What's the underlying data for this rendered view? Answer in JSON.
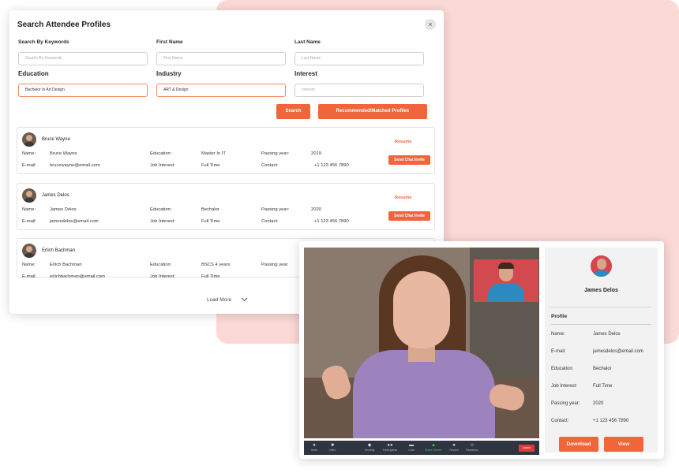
{
  "search": {
    "title": "Search Attendee Profiles",
    "close_icon": "×",
    "fields": {
      "keywords": {
        "label": "Search By Keywords",
        "placeholder": "Search By Keywords"
      },
      "first_name": {
        "label": "First Name",
        "placeholder": "First Name"
      },
      "last_name": {
        "label": "Last Name",
        "placeholder": "Last Name"
      },
      "education": {
        "label": "Education",
        "value": "Bachelor In Art Design"
      },
      "industry": {
        "label": "Industry",
        "value": "ART & Design"
      },
      "interest": {
        "label": "Interest",
        "placeholder": "Interest"
      }
    },
    "search_button": "Search",
    "matched_button": "Recommended/Matched Profiles",
    "load_more": "Load More"
  },
  "labels": {
    "name": "Name:",
    "email": "E-mail:",
    "education": "Education:",
    "job_interest": "Job Interest:",
    "passing_year": "Passing year:",
    "contact": "Contact:",
    "resume": "Resume",
    "send_invite": "Send Chat Invite"
  },
  "attendees": [
    {
      "name": "Bruce Wayne",
      "email": "brucewayne@email.com",
      "education": "Master In IT",
      "job_interest": "Full Time",
      "passing_year": "2019",
      "contact": "+1 123 456 7890"
    },
    {
      "name": "James Delos",
      "email": "jamesdelos@email.com",
      "education": "Bechalor",
      "job_interest": "Full Time",
      "passing_year": "2020",
      "contact": "+1 123 456 7890"
    },
    {
      "name": "Erlich Bachman",
      "email": "erlichbachman@email.com",
      "education": "BSCS 4 years",
      "job_interest": "Full Time",
      "passing_year": "Passing year"
    }
  ],
  "video_call": {
    "toolbar": [
      {
        "label": "Mute",
        "icon": "microphone-icon"
      },
      {
        "label": "Video",
        "icon": "camera-icon"
      },
      {
        "label": "Security",
        "icon": "shield-icon"
      },
      {
        "label": "Participants",
        "icon": "people-icon"
      },
      {
        "label": "Chat",
        "icon": "chat-icon"
      },
      {
        "label": "Share Screen",
        "icon": "share-screen-icon"
      },
      {
        "label": "Record",
        "icon": "record-icon"
      },
      {
        "label": "Reactions",
        "icon": "smile-icon"
      }
    ],
    "leave": "Leave",
    "profile": {
      "name": "James Delos",
      "heading": "Profile",
      "rows": [
        {
          "key": "Name:",
          "value": "James Delos"
        },
        {
          "key": "E-mail:",
          "value": "jamesdelos@email.com"
        },
        {
          "key": "Education:",
          "value": "Bechalor"
        },
        {
          "key": "Job Interest:",
          "value": "Full Time"
        },
        {
          "key": "Passing year:",
          "value": "2020"
        },
        {
          "key": "Contact:",
          "value": "+1 123 456 7890"
        }
      ],
      "download_button": "Download",
      "view_button": "View"
    }
  },
  "colors": {
    "accent": "#f2643a",
    "blob": "#fad9d6",
    "toolbar": "#2e3440",
    "leave": "#e0383b"
  }
}
